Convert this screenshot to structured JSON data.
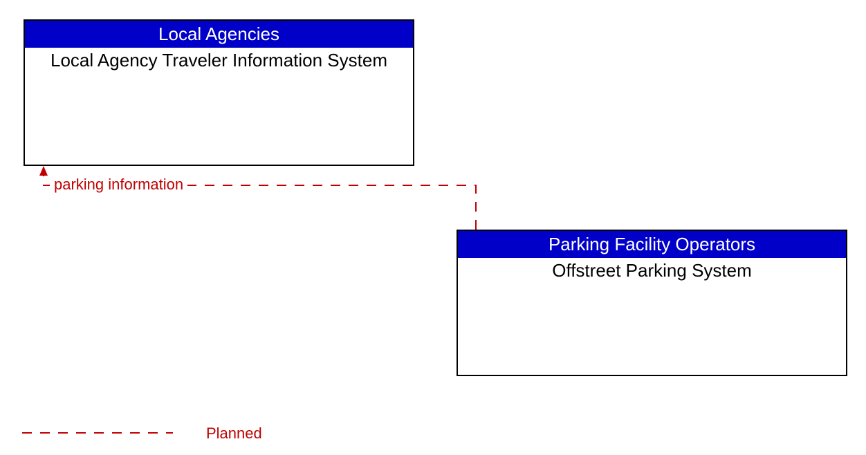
{
  "boxes": {
    "local_agencies": {
      "header": "Local Agencies",
      "body": "Local Agency Traveler Information System"
    },
    "parking_operators": {
      "header": "Parking Facility Operators",
      "body": "Offstreet Parking System"
    }
  },
  "flows": {
    "parking_info": "parking information"
  },
  "legend": {
    "planned": "Planned"
  },
  "colors": {
    "header_bg": "#0000c8",
    "flow": "#c00000"
  }
}
